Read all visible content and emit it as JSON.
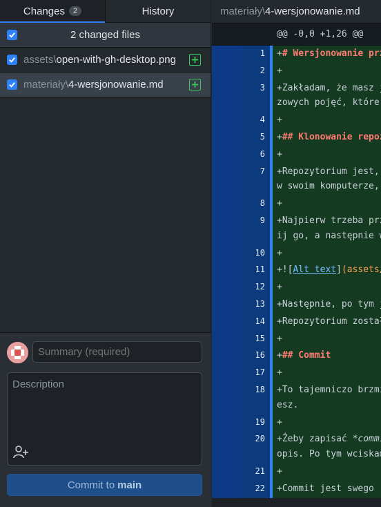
{
  "tabs": {
    "changes_label": "Changes",
    "changes_count": "2",
    "history_label": "History"
  },
  "files_header": {
    "label": "2 changed files"
  },
  "files": [
    {
      "dir": "assets\\",
      "name": "open-with-gh-desktop.png"
    },
    {
      "dir": "materiały\\",
      "name": "4-wersjonowanie.md"
    }
  ],
  "commit": {
    "summary_placeholder": "Summary (required)",
    "description_placeholder": "Description",
    "button_prefix": "Commit to",
    "branch": "main"
  },
  "diff": {
    "file_dir": "materiały\\",
    "file_name": "4-wersjonowanie.md",
    "hunk_header": "@@ -0,0 +1,26 @@",
    "lines": [
      {
        "n": "1",
        "rows": [
          "+# Wersjonowanie prz"
        ],
        "style": "h"
      },
      {
        "n": "2",
        "rows": [
          "+"
        ]
      },
      {
        "n": "3",
        "rows": [
          "+Zakładam, że masz j",
          "zowych pojęć, które "
        ]
      },
      {
        "n": "4",
        "rows": [
          "+"
        ]
      },
      {
        "n": "5",
        "rows": [
          "+## Klonowanie repoz"
        ],
        "style": "h"
      },
      {
        "n": "6",
        "rows": [
          "+"
        ]
      },
      {
        "n": "7",
        "rows": [
          "+Repozytorium jest, ",
          "w swoim komputerze, "
        ]
      },
      {
        "n": "8",
        "rows": [
          "+"
        ]
      },
      {
        "n": "9",
        "rows": [
          "+Najpierw trzeba prz",
          "ij go, a następnie w"
        ]
      },
      {
        "n": "10",
        "rows": [
          "+"
        ]
      },
      {
        "n": "11",
        "rows": [
          "+![Alt text](assets/"
        ],
        "style": "img"
      },
      {
        "n": "12",
        "rows": [
          "+"
        ]
      },
      {
        "n": "13",
        "rows": [
          "+Następnie, po tym j"
        ]
      },
      {
        "n": "14",
        "rows": [
          "+Repozytorium został"
        ]
      },
      {
        "n": "15",
        "rows": [
          "+"
        ]
      },
      {
        "n": "16",
        "rows": [
          "+## Commit"
        ],
        "style": "h"
      },
      {
        "n": "17",
        "rows": [
          "+"
        ]
      },
      {
        "n": "18",
        "rows": [
          "+To tajemniczo brzmi",
          "esz."
        ]
      },
      {
        "n": "19",
        "rows": [
          "+"
        ]
      },
      {
        "n": "20",
        "rows": [
          "+Żeby zapisać *commi",
          "opis. Po tym wciskam"
        ],
        "style": "it"
      },
      {
        "n": "21",
        "rows": [
          "+"
        ]
      },
      {
        "n": "22",
        "rows": [
          "+Commit jest swego r"
        ]
      }
    ]
  },
  "colors": {
    "accent": "#2f81f7",
    "added_green": "#34d058",
    "heading_red": "#ff7b72"
  }
}
